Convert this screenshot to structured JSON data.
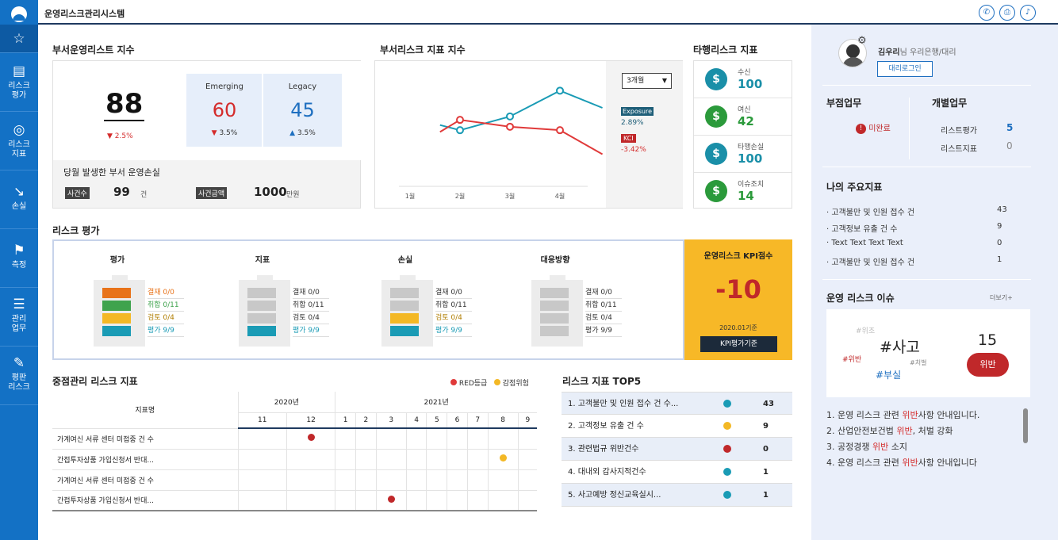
{
  "app": {
    "title": "운영리스크관리시스템"
  },
  "topbar": {
    "icons": [
      "phone-icon",
      "print-icon",
      "bell-icon"
    ]
  },
  "sidebar": {
    "items": [
      {
        "label": "",
        "icon": "star-list-icon"
      },
      {
        "label": "리스크\n평가",
        "icon": "film-icon"
      },
      {
        "label": "리스크\n지표",
        "icon": "gauge-icon"
      },
      {
        "label": "손실",
        "icon": "trend-down-icon"
      },
      {
        "label": "측정",
        "icon": "flag-icon"
      },
      {
        "label": "관리\n업무",
        "icon": "list-icon"
      },
      {
        "label": "평판\n리스크",
        "icon": "edit-icon"
      }
    ]
  },
  "dept_index": {
    "title": "부서운영리스트 지수",
    "main_value": "88",
    "main_change": "2.5%",
    "emerging": {
      "label": "Emerging",
      "value": "60",
      "change": "3.5%"
    },
    "legacy": {
      "label": "Legacy",
      "value": "45",
      "change": "3.5%"
    },
    "loss_title": "당월 발생한 부서 운영손실",
    "case_label": "사건수",
    "case_value": "99",
    "case_unit": "건",
    "amount_label": "사건금액",
    "amount_value": "1000",
    "amount_unit": "만원"
  },
  "dept_risk_chart": {
    "title": "부서리스크 지표 지수",
    "period_select": "3개월",
    "legend": [
      {
        "name": "Exposure",
        "change": "2.89%",
        "color": "#1a8fa8"
      },
      {
        "name": "KCI",
        "change": "-3.42%",
        "color": "#e03a3a"
      }
    ]
  },
  "chart_data": {
    "type": "line",
    "categories": [
      "1월",
      "2월",
      "3월",
      "4월"
    ],
    "series": [
      {
        "name": "Exposure",
        "color": "#1a9bb5",
        "values": [
          52,
          49,
          57,
          72,
          62
        ]
      },
      {
        "name": "KCI",
        "color": "#e03a3a",
        "values": [
          48,
          55,
          51,
          49,
          35
        ]
      }
    ],
    "x": [
      0.6,
      1,
      2,
      3,
      3.85
    ],
    "ylim": [
      20,
      80
    ]
  },
  "other_risk": {
    "title": "타행리스크 지표",
    "items": [
      {
        "label": "수신",
        "value": "100",
        "color": "#1a8fa8"
      },
      {
        "label": "여신",
        "value": "42",
        "color": "#2b9a3b"
      },
      {
        "label": "타행손실",
        "value": "100",
        "color": "#1a8fa8"
      },
      {
        "label": "이슈조치",
        "value": "14",
        "color": "#2b9a3b"
      }
    ]
  },
  "risk_eval": {
    "title": "리스크 평가",
    "columns": [
      {
        "title": "평가",
        "rows": [
          {
            "label": "결재 0/0",
            "color": "#e8731a",
            "text_color": "#e8731a"
          },
          {
            "label": "취합 0/11",
            "color": "#3fa34d",
            "text_color": "#3fa34d"
          },
          {
            "label": "검토 0/4",
            "color": "#f3b825",
            "text_color": "#b07d00"
          },
          {
            "label": "평가 9/9",
            "color": "#1a9bb5",
            "text_color": "#1a9bb5"
          }
        ]
      },
      {
        "title": "지표",
        "rows": [
          {
            "label": "결재 0/0",
            "color": "#c8c8c8",
            "text_color": "#333"
          },
          {
            "label": "취합 0/11",
            "color": "#c8c8c8",
            "text_color": "#333"
          },
          {
            "label": "검토 0/4",
            "color": "#c8c8c8",
            "text_color": "#333"
          },
          {
            "label": "평가 9/9",
            "color": "#1a9bb5",
            "text_color": "#1a9bb5"
          }
        ]
      },
      {
        "title": "손실",
        "rows": [
          {
            "label": "결재 0/0",
            "color": "#c8c8c8",
            "text_color": "#333"
          },
          {
            "label": "취합 0/11",
            "color": "#c8c8c8",
            "text_color": "#333"
          },
          {
            "label": "검토 0/4",
            "color": "#f3b825",
            "text_color": "#b07d00"
          },
          {
            "label": "평가 9/9",
            "color": "#1a9bb5",
            "text_color": "#1a9bb5"
          }
        ]
      },
      {
        "title": "대응방향",
        "rows": [
          {
            "label": "결재 0/0",
            "color": "#c8c8c8",
            "text_color": "#333"
          },
          {
            "label": "취합 0/11",
            "color": "#c8c8c8",
            "text_color": "#333"
          },
          {
            "label": "검토 0/4",
            "color": "#c8c8c8",
            "text_color": "#333"
          },
          {
            "label": "평가 9/9",
            "color": "#c8c8c8",
            "text_color": "#333"
          }
        ]
      }
    ],
    "kpi": {
      "title": "운영리스크 KPI점수",
      "value": "-10",
      "date": "2020.01기준",
      "button": "KPI평가기준"
    }
  },
  "focus_kri": {
    "title": "중점관리 리스크 지표",
    "legend": [
      {
        "name": "RED등급",
        "color": "#e03a3a"
      },
      {
        "name": "감점위험",
        "color": "#f3b825"
      }
    ],
    "col_header": "지표명",
    "years": [
      "2020년",
      "2021년"
    ],
    "months": [
      "11",
      "12",
      "1",
      "2",
      "3",
      "4",
      "5",
      "6",
      "7",
      "8",
      "9"
    ],
    "rows": [
      {
        "name": "가계여신 서류 센터 미접중 건 수",
        "mark_col": 1,
        "mark_color": "#c0282a"
      },
      {
        "name": "간접투자상품 가입신청서 반대...",
        "mark_col": 9,
        "mark_color": "#f3b825"
      },
      {
        "name": "가계여신 서류 센터 미접중 건 수",
        "mark_col": -1,
        "mark_color": ""
      },
      {
        "name": "간접투자상품 가입신청서 반대...",
        "mark_col": 4,
        "mark_color": "#c0282a"
      }
    ]
  },
  "top5": {
    "title": "리스크 지표 TOP5",
    "rows": [
      {
        "name": "1. 고객불만 및 인원 접수 건 수...",
        "color": "#1a9bb5",
        "value": "43"
      },
      {
        "name": "2. 고객정보 유출 건 수",
        "color": "#f3b825",
        "value": "9"
      },
      {
        "name": "3. 관련법규 위반건수",
        "color": "#c0282a",
        "value": "0"
      },
      {
        "name": "4. 대내외 감사지적건수",
        "color": "#1a9bb5",
        "value": "1"
      },
      {
        "name": "5. 사고예방 정신교육실시...",
        "color": "#1a9bb5",
        "value": "1"
      }
    ]
  },
  "profile": {
    "name": "김우리",
    "suffix": "님",
    "org": "우리은행/대리",
    "login_button": "대리로그인"
  },
  "branch_work": {
    "title": "부점업무",
    "status": "미완료"
  },
  "personal_work": {
    "title": "개별업무",
    "items": [
      {
        "label": "리스트평가",
        "value": "5"
      },
      {
        "label": "리스트지표",
        "value": "0"
      }
    ]
  },
  "my_kri": {
    "title": "나의 주요지표",
    "items": [
      {
        "label": "· 고객불만 및 인원 접수 건",
        "value": "43"
      },
      {
        "label": "· 고객정보 유출 건 수",
        "value": "9"
      },
      {
        "label": "· Text Text Text Text",
        "value": "0"
      },
      {
        "label": "· 고객불만 및 인원 접수 건",
        "value": "1"
      }
    ]
  },
  "issues": {
    "title": "운영 리스크 이슈",
    "more": "더보기+",
    "tags": {
      "t1": "#위조",
      "t2": "#사고",
      "t3": "#위반",
      "t4": "#처벌",
      "t5": "#부실"
    },
    "count": "15",
    "badge": "위반",
    "list": [
      {
        "pre": "1. 운영 리스크 관련 ",
        "hl": "위반",
        "post": "사항 안내입니다."
      },
      {
        "pre": "2. 산업안전보건법 ",
        "hl": "위반",
        "post": ", 처벌 강화"
      },
      {
        "pre": "3. 공정경쟁 ",
        "hl": "위반",
        "post": " 소지"
      },
      {
        "pre": "4. 운영 리스크 관련 ",
        "hl": "위반",
        "post": "사항 안내입니다"
      }
    ]
  }
}
